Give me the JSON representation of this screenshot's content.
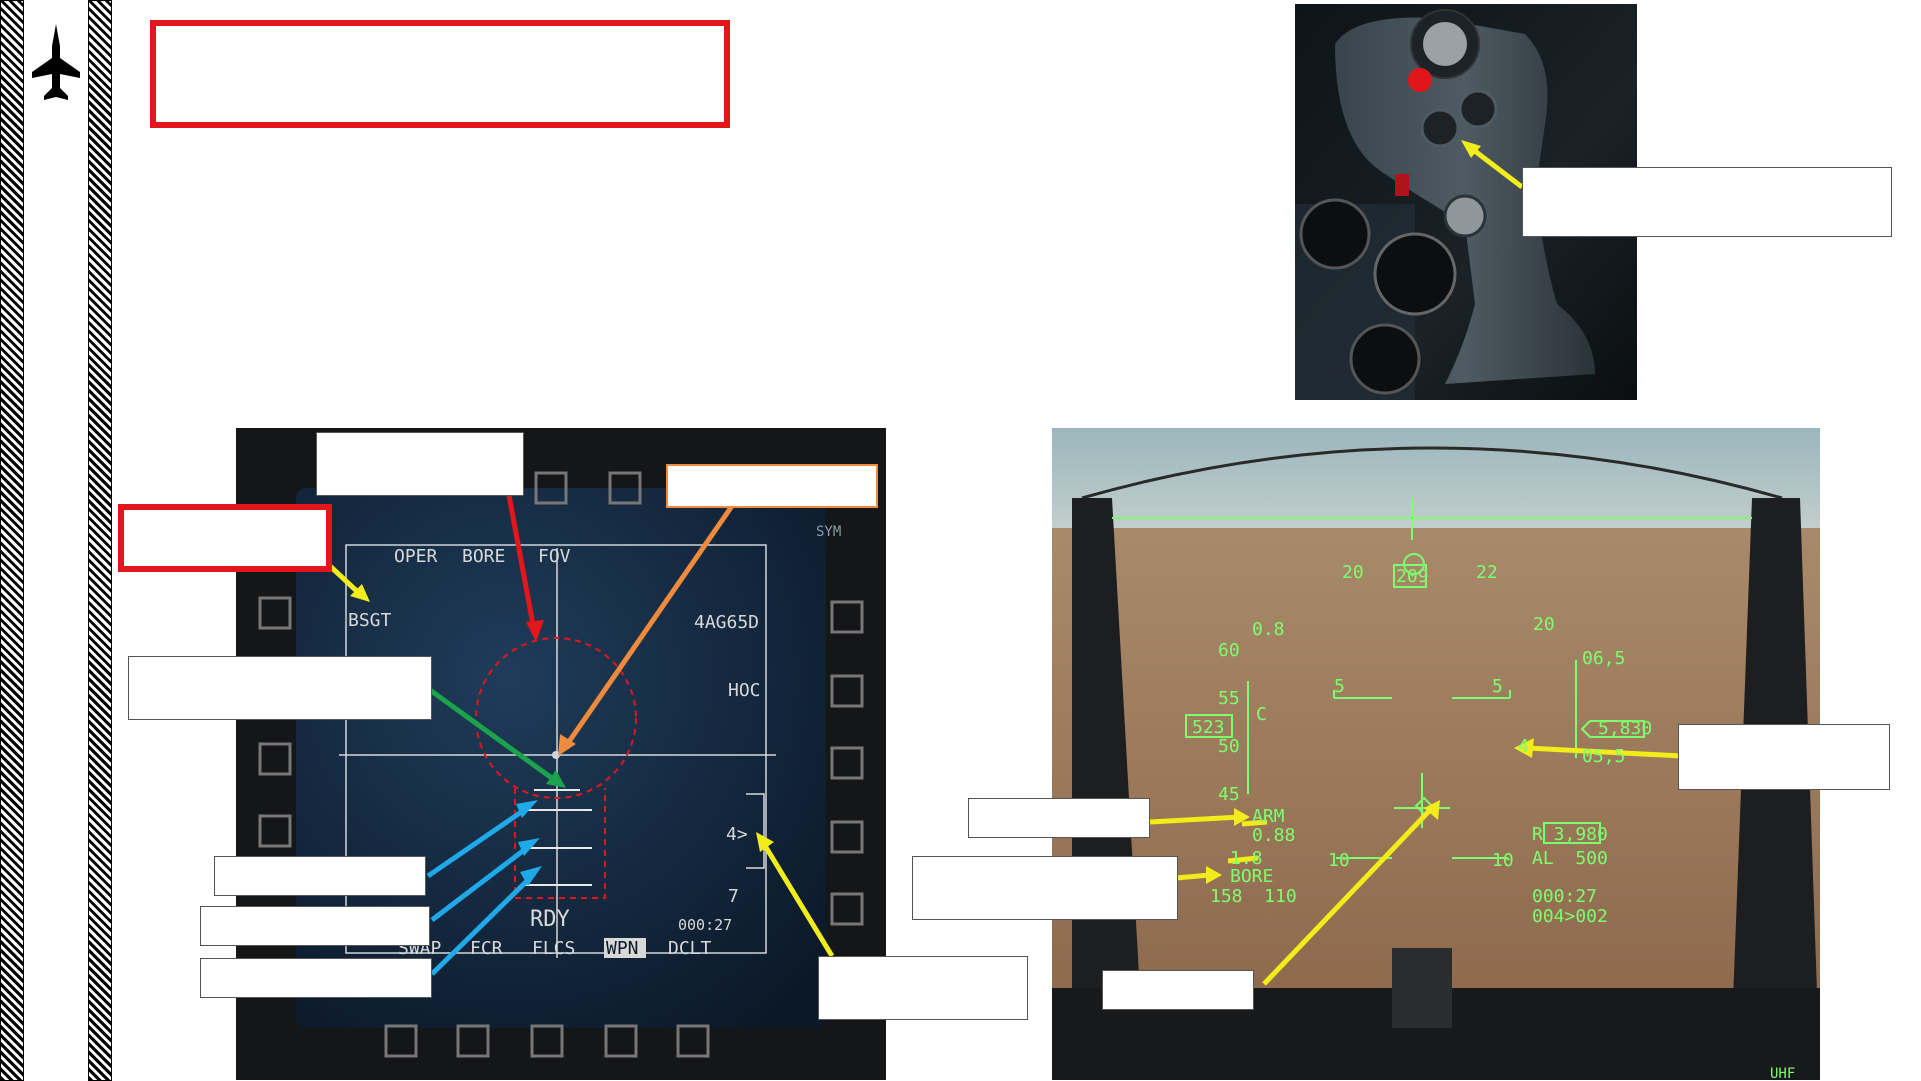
{
  "mfd": {
    "top_labels": [
      "OPER",
      "BORE",
      "FOV"
    ],
    "left_label": "BSGT",
    "right_labels": [
      "4AG65D",
      "HOC"
    ],
    "status": "RDY",
    "timer": "000:27",
    "bottom_labels": [
      "SWAP",
      "FCR",
      "FLCS",
      "WPN",
      "DCLT"
    ],
    "selected_bottom": "WPN",
    "sym_label": "SYM",
    "range_caret": "4>",
    "scale_value": "7"
  },
  "hud": {
    "heading_left": "20",
    "heading_center": "209",
    "heading_right": "22",
    "mach_top": "0.8",
    "speed_scale": [
      "60",
      "55",
      "50",
      "45"
    ],
    "airspeed": "523",
    "speed_marker": "C",
    "pitch_left": "5",
    "pitch_right": "5",
    "pitch_low_left": "10",
    "pitch_low_right": "10",
    "alt_top": "20",
    "alt_scale": [
      "06,5",
      "05,5"
    ],
    "altitude": "5,830",
    "alt_caret": "4",
    "arm_label": "ARM",
    "arm_value": "0.88",
    "g_value": "1.8",
    "bore_label": "BORE",
    "bore_values": "158  110",
    "range_value": "R 3,980",
    "al_value": "AL  500",
    "time_value": "000:27",
    "steerpoint": "004>002",
    "radio_label": "UHF"
  },
  "colors": {
    "red": "#e3161b",
    "yellow": "#f2ec1a",
    "green": "#1aa34a",
    "blue": "#1fa9e8",
    "orange": "#f08a3c",
    "hud_green": "#7dff6e"
  },
  "icons": [
    "jet-icon"
  ]
}
